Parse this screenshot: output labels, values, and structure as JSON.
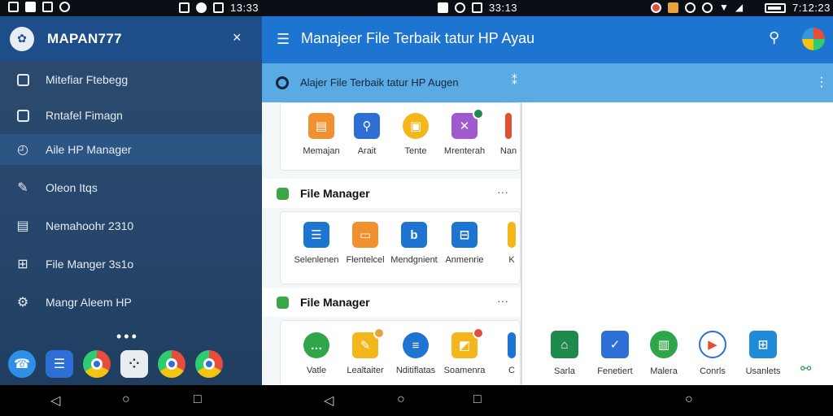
{
  "status_bar": {
    "time_left": "13:33",
    "time_mid": "33:13",
    "time_right": "7:12:23"
  },
  "drawer": {
    "title": "MAPAN777",
    "close_icon": "×",
    "items": [
      {
        "label": "Mitefiar Ftebegg",
        "icon": "square-icon"
      },
      {
        "label": "Rntafel Fimagn",
        "icon": "panel-icon"
      },
      {
        "label": "Aile HP Manager",
        "icon": "clock-icon"
      },
      {
        "label": "Oleon Itqs",
        "icon": "pen-icon"
      },
      {
        "label": "Nemahoohr 2310",
        "icon": "sim-icon"
      },
      {
        "label": "File Manger 3s1o",
        "icon": "gamepad-icon"
      },
      {
        "label": "Mangr Aleem HP",
        "icon": "gear-icon"
      }
    ],
    "active_index": 2
  },
  "app_bar": {
    "title": "Manajeer File Terbaik tatur HP Ayau"
  },
  "sub_bar": {
    "title": "Alajer File Terbaik tatur HP Augen"
  },
  "row1": [
    {
      "label": "Memajan",
      "color": "#f2902f",
      "icon": "document-icon"
    },
    {
      "label": "Arait",
      "color": "#2d6fd6",
      "icon": "search-icon"
    },
    {
      "label": "Tente",
      "color": "#f3b71c",
      "icon": "box-icon"
    },
    {
      "label": "Mrenterah",
      "color": "#a05ad0",
      "icon": "image-icon"
    },
    {
      "label": "Nan",
      "color": "#e14f2e",
      "icon": "bar-icon"
    }
  ],
  "section1": {
    "title": "File Manager",
    "more": "···"
  },
  "row2": [
    {
      "label": "Selenlenen",
      "color": "#1e74d1",
      "icon": "file-list-icon"
    },
    {
      "label": "Flentelcel",
      "color": "#f2902f",
      "icon": "folder-icon"
    },
    {
      "label": "Mendgnient",
      "color": "#1e74d1",
      "icon": "drive-icon"
    },
    {
      "label": "Anmenrie",
      "color": "#1e74d1",
      "icon": "storage-icon"
    },
    {
      "label": "K",
      "color": "#f3b71c",
      "icon": "box-icon"
    }
  ],
  "section2": {
    "title": "File Manager",
    "more": "···"
  },
  "row3": [
    {
      "label": "Vatle",
      "color": "#2fa64a",
      "icon": "chat-icon"
    },
    {
      "label": "Lealtaiter",
      "color": "#f3b71c",
      "icon": "folder-icon"
    },
    {
      "label": "Nditiflatas",
      "color": "#1e74d1",
      "icon": "note-icon"
    },
    {
      "label": "Soamenra",
      "color": "#f3b71c",
      "icon": "gallery-icon"
    },
    {
      "label": "C",
      "color": "#1e74d1",
      "icon": "drive-icon"
    }
  ],
  "bottom_apps": [
    {
      "label": "Sarla",
      "color": "#1e8a4c",
      "icon": "home-icon"
    },
    {
      "label": "Fenetiert",
      "color": "#2d6fd6",
      "icon": "check-icon"
    },
    {
      "label": "Malera",
      "color": "#2fa64a",
      "icon": "stats-icon"
    },
    {
      "label": "Conrls",
      "color": "#ffffff",
      "icon": "play-icon"
    },
    {
      "label": "Usanlets",
      "color": "#1e8ad8",
      "icon": "grid-icon"
    }
  ]
}
